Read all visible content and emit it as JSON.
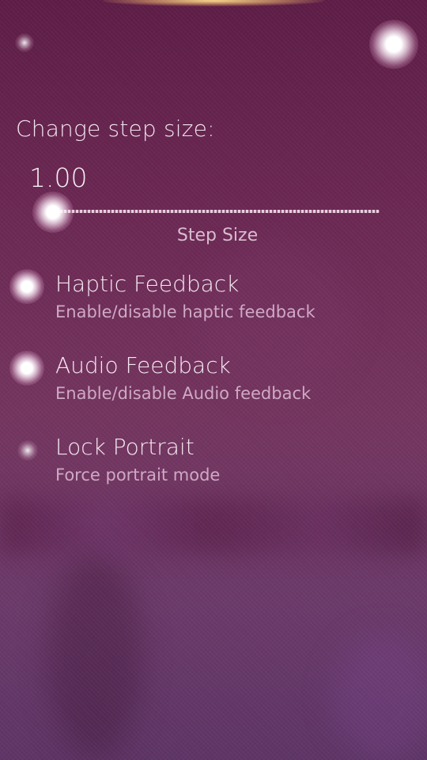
{
  "step_size": {
    "heading": "Change step size:",
    "value": "1.00",
    "label": "Step Size",
    "slider_fraction": 0.0
  },
  "switches": [
    {
      "title": "Haptic Feedback",
      "description": "Enable/disable haptic feedback",
      "checked": true
    },
    {
      "title": "Audio Feedback",
      "description": "Enable/disable Audio feedback",
      "checked": true
    },
    {
      "title": "Lock Portrait",
      "description": "Force portrait mode",
      "checked": false
    }
  ],
  "colors": {
    "background": "#6a2752",
    "highlight": "#ffffff",
    "secondary_text": "#cfa9c4",
    "pulley_glow": "#ffe18c"
  }
}
